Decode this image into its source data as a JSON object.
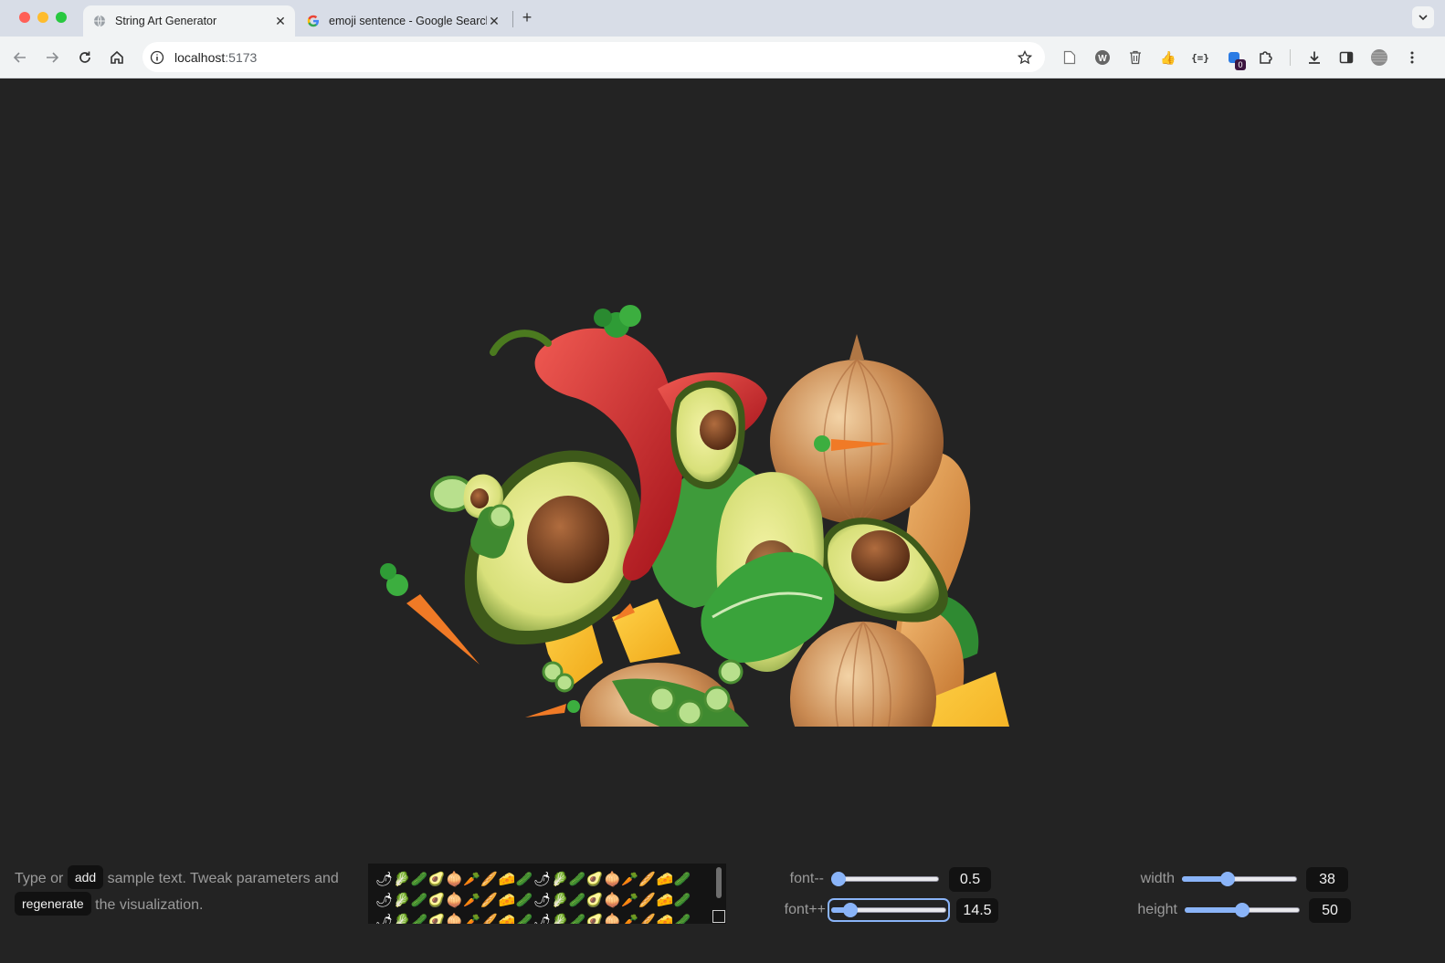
{
  "browser": {
    "tabs": [
      {
        "title": "String Art Generator",
        "active": true,
        "favicon": "globe-icon"
      },
      {
        "title": "emoji sentence - Google Search",
        "active": false,
        "favicon": "google-icon"
      }
    ],
    "url_host": "localhost",
    "url_port": ":5173",
    "extension_badge": "0"
  },
  "app": {
    "intro": {
      "part1": "Type or",
      "add_label": "add",
      "part2": "sample text. Tweak parameters and",
      "regenerate_label": "regenerate",
      "part3": "the visualization."
    },
    "sample_text": "🌶🥬🥒🥑🧅🥕🥖🧀🥒🌶🥬🥒🥑🧅🥕🥖🧀🥒🌶🥬🥒🥑🧅🥕🥖🧀🥒🌶🥬🥒🥑🧅🥕🥖🧀🥒🌶🥬🥒🥑🧅🥕🥖🧀🥒🌶🥬🥒🥑🧅🥕🥖🧀🥒🌶🥬🥒🥑🧅🥕🥖🧀🥒",
    "params": {
      "font_min": {
        "label": "font--",
        "value": "0.5",
        "fraction": 0.0
      },
      "font_max": {
        "label": "font++",
        "value": "14.5",
        "fraction": 0.12
      },
      "width": {
        "label": "width",
        "value": "38",
        "fraction": 0.38
      },
      "height": {
        "label": "height",
        "value": "50",
        "fraction": 0.5
      }
    }
  },
  "colors": {
    "background": "#232323",
    "accent": "#8ab4f8",
    "value_box": "#121212"
  }
}
